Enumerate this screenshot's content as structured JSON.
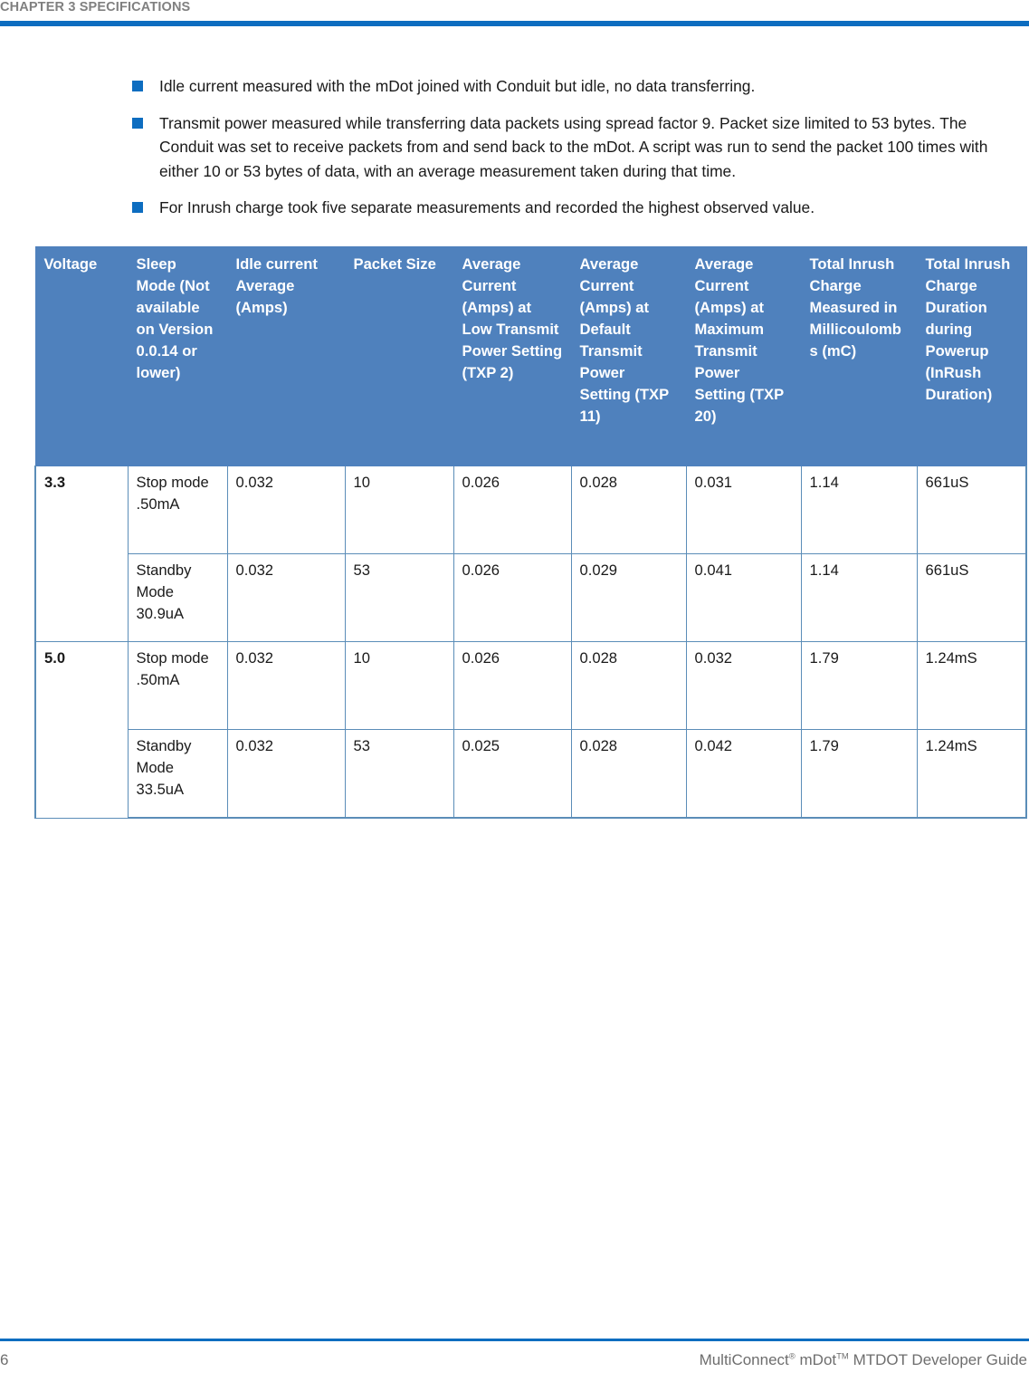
{
  "header": {
    "chapter": "CHAPTER 3 SPECIFICATIONS"
  },
  "bullets": [
    "Idle current measured with the mDot joined with Conduit but idle, no data transferring.",
    "Transmit power measured while transferring data packets using spread factor 9. Packet size limited to 53 bytes. The Conduit was set to receive packets from and send back to the mDot. A script was run to send the packet 100 times with either 10 or 53 bytes of data, with an average measurement taken during that time.",
    "For Inrush charge took five separate measurements and recorded the highest observed value."
  ],
  "table": {
    "columns": [
      "Voltage",
      "Sleep Mode (Not available on Version 0.0.14 or lower)",
      "Idle current Average (Amps)",
      "Packet Size",
      "Average Current (Amps) at Low Transmit Power Setting (TXP 2)",
      "Average Current (Amps) at Default Transmit Power Setting (TXP 11)",
      "Average Current (Amps) at Maximum Transmit Power Setting (TXP 20)",
      "Total Inrush Charge Measured in Millicoulombs (mC)",
      "Total Inrush Charge Duration during Powerup (InRush Duration)"
    ],
    "rows": [
      [
        "3.3",
        "Stop mode .50mA",
        "0.032",
        "10",
        "0.026",
        "0.028",
        "0.031",
        "1.14",
        "661uS"
      ],
      [
        "",
        "Standby Mode 30.9uA",
        "0.032",
        "53",
        "0.026",
        "0.029",
        "0.041",
        "1.14",
        "661uS"
      ],
      [
        "5.0",
        "Stop mode .50mA",
        "0.032",
        "10",
        "0.026",
        "0.028",
        "0.032",
        "1.79",
        "1.24mS"
      ],
      [
        "",
        "Standby Mode 33.5uA",
        "0.032",
        "53",
        "0.025",
        "0.028",
        "0.042",
        "1.79",
        "1.24mS"
      ]
    ]
  },
  "footer": {
    "page_number": "6",
    "guide_main": "MultiConnect",
    "guide_reg": "®",
    "guide_mid": " mDot",
    "guide_tm": "TM",
    "guide_end": " MTDOT Developer Guide"
  },
  "colors": {
    "accent_rule": "#0d6dc0",
    "table_header_fill": "#4f81bd",
    "table_border": "#5b8db8",
    "header_text": "#808080",
    "footer_text": "#6e6e6e"
  }
}
